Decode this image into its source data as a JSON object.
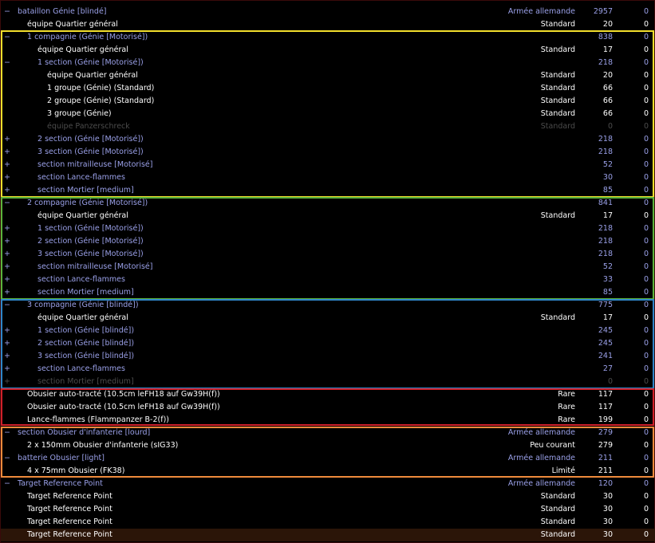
{
  "colors": {
    "group_text": "#9aa0e8",
    "unit_text": "#ffffff",
    "disabled_text": "#4c4c4c",
    "highlight_row": "#2b1508",
    "box_yellow": "#f2de2c",
    "box_green": "#5cb43c",
    "box_blue": "#2f86c9",
    "box_red": "#d0202a",
    "box_orange": "#ef8a3c"
  },
  "rows": [
    {
      "exp": "−",
      "name": "bataillon Génie [blindé]",
      "cat": "Armée allemande",
      "pts": "2957",
      "last": "0",
      "indent": 1,
      "tone": "group"
    },
    {
      "exp": "",
      "name": "équipe Quartier général",
      "cat": "Standard",
      "pts": "20",
      "last": "0",
      "indent": 2,
      "tone": "unit"
    },
    {
      "exp": "−",
      "name": "1 compagnie (Génie [Motorisé])",
      "cat": "",
      "pts": "838",
      "last": "0",
      "indent": 2,
      "tone": "group"
    },
    {
      "exp": "",
      "name": "équipe Quartier général",
      "cat": "Standard",
      "pts": "17",
      "last": "0",
      "indent": 3,
      "tone": "unit"
    },
    {
      "exp": "−",
      "name": "1 section (Génie [Motorisé])",
      "cat": "",
      "pts": "218",
      "last": "0",
      "indent": 3,
      "tone": "group"
    },
    {
      "exp": "",
      "name": "équipe Quartier général",
      "cat": "Standard",
      "pts": "20",
      "last": "0",
      "indent": 4,
      "tone": "unit"
    },
    {
      "exp": "",
      "name": "1 groupe (Génie) (Standard)",
      "cat": "Standard",
      "pts": "66",
      "last": "0",
      "indent": 4,
      "tone": "unit"
    },
    {
      "exp": "",
      "name": "2 groupe (Génie) (Standard)",
      "cat": "Standard",
      "pts": "66",
      "last": "0",
      "indent": 4,
      "tone": "unit"
    },
    {
      "exp": "",
      "name": "3 groupe (Génie)",
      "cat": "Standard",
      "pts": "66",
      "last": "0",
      "indent": 4,
      "tone": "unit"
    },
    {
      "exp": "",
      "name": "équipe Panzerschreck",
      "cat": "Standard",
      "pts": "0",
      "last": "0",
      "indent": 4,
      "tone": "dim"
    },
    {
      "exp": "+",
      "name": "2 section (Génie [Motorisé])",
      "cat": "",
      "pts": "218",
      "last": "0",
      "indent": 3,
      "tone": "group"
    },
    {
      "exp": "+",
      "name": "3 section (Génie [Motorisé])",
      "cat": "",
      "pts": "218",
      "last": "0",
      "indent": 3,
      "tone": "group"
    },
    {
      "exp": "+",
      "name": "section mitrailleuse [Motorisé]",
      "cat": "",
      "pts": "52",
      "last": "0",
      "indent": 3,
      "tone": "group"
    },
    {
      "exp": "+",
      "name": "section Lance-flammes",
      "cat": "",
      "pts": "30",
      "last": "0",
      "indent": 3,
      "tone": "group"
    },
    {
      "exp": "+",
      "name": "section Mortier [medium]",
      "cat": "",
      "pts": "85",
      "last": "0",
      "indent": 3,
      "tone": "group"
    },
    {
      "exp": "−",
      "name": "2 compagnie (Génie [Motorisé])",
      "cat": "",
      "pts": "841",
      "last": "0",
      "indent": 2,
      "tone": "group"
    },
    {
      "exp": "",
      "name": "équipe Quartier général",
      "cat": "Standard",
      "pts": "17",
      "last": "0",
      "indent": 3,
      "tone": "unit"
    },
    {
      "exp": "+",
      "name": "1 section (Génie [Motorisé])",
      "cat": "",
      "pts": "218",
      "last": "0",
      "indent": 3,
      "tone": "group"
    },
    {
      "exp": "+",
      "name": "2 section (Génie [Motorisé])",
      "cat": "",
      "pts": "218",
      "last": "0",
      "indent": 3,
      "tone": "group"
    },
    {
      "exp": "+",
      "name": "3 section (Génie [Motorisé])",
      "cat": "",
      "pts": "218",
      "last": "0",
      "indent": 3,
      "tone": "group"
    },
    {
      "exp": "+",
      "name": "section mitrailleuse [Motorisé]",
      "cat": "",
      "pts": "52",
      "last": "0",
      "indent": 3,
      "tone": "group"
    },
    {
      "exp": "+",
      "name": "section Lance-flammes",
      "cat": "",
      "pts": "33",
      "last": "0",
      "indent": 3,
      "tone": "group"
    },
    {
      "exp": "+",
      "name": "section Mortier [medium]",
      "cat": "",
      "pts": "85",
      "last": "0",
      "indent": 3,
      "tone": "group"
    },
    {
      "exp": "−",
      "name": "3 compagnie (Génie [blindé])",
      "cat": "",
      "pts": "775",
      "last": "0",
      "indent": 2,
      "tone": "group"
    },
    {
      "exp": "",
      "name": "équipe Quartier général",
      "cat": "Standard",
      "pts": "17",
      "last": "0",
      "indent": 3,
      "tone": "unit"
    },
    {
      "exp": "+",
      "name": "1 section (Génie [blindé])",
      "cat": "",
      "pts": "245",
      "last": "0",
      "indent": 3,
      "tone": "group"
    },
    {
      "exp": "+",
      "name": "2 section (Génie [blindé])",
      "cat": "",
      "pts": "245",
      "last": "0",
      "indent": 3,
      "tone": "group"
    },
    {
      "exp": "+",
      "name": "3 section (Génie [blindé])",
      "cat": "",
      "pts": "241",
      "last": "0",
      "indent": 3,
      "tone": "group"
    },
    {
      "exp": "+",
      "name": "section Lance-flammes",
      "cat": "",
      "pts": "27",
      "last": "0",
      "indent": 3,
      "tone": "group"
    },
    {
      "exp": "+",
      "name": "section Mortier [medium]",
      "cat": "",
      "pts": "0",
      "last": "0",
      "indent": 3,
      "tone": "dim"
    },
    {
      "exp": "",
      "name": "Obusier auto-tracté (10.5cm leFH18 auf Gw39H(f))",
      "cat": "Rare",
      "pts": "117",
      "last": "0",
      "indent": 2,
      "tone": "unit"
    },
    {
      "exp": "",
      "name": "Obusier auto-tracté (10.5cm leFH18 auf Gw39H(f))",
      "cat": "Rare",
      "pts": "117",
      "last": "0",
      "indent": 2,
      "tone": "unit"
    },
    {
      "exp": "",
      "name": "Lance-flammes (Flammpanzer B-2(f))",
      "cat": "Rare",
      "pts": "199",
      "last": "0",
      "indent": 2,
      "tone": "unit"
    },
    {
      "exp": "−",
      "name": "section Obusier d'infanterie [lourd]",
      "cat": "Armée allemande",
      "pts": "279",
      "last": "0",
      "indent": 1,
      "tone": "group"
    },
    {
      "exp": "",
      "name": "2 x 150mm Obusier d'infanterie (sIG33)",
      "cat": "Peu courant",
      "pts": "279",
      "last": "0",
      "indent": 2,
      "tone": "unit"
    },
    {
      "exp": "−",
      "name": "batterie Obusier [light]",
      "cat": "Armée allemande",
      "pts": "211",
      "last": "0",
      "indent": 1,
      "tone": "group"
    },
    {
      "exp": "",
      "name": "4 x 75mm Obusier (FK38)",
      "cat": "Limité",
      "pts": "211",
      "last": "0",
      "indent": 2,
      "tone": "unit"
    },
    {
      "exp": "−",
      "name": "Target Reference Point",
      "cat": "Armée allemande",
      "pts": "120",
      "last": "0",
      "indent": 1,
      "tone": "group"
    },
    {
      "exp": "",
      "name": "Target Reference Point",
      "cat": "Standard",
      "pts": "30",
      "last": "0",
      "indent": 2,
      "tone": "unit"
    },
    {
      "exp": "",
      "name": "Target Reference Point",
      "cat": "Standard",
      "pts": "30",
      "last": "0",
      "indent": 2,
      "tone": "unit"
    },
    {
      "exp": "",
      "name": "Target Reference Point",
      "cat": "Standard",
      "pts": "30",
      "last": "0",
      "indent": 2,
      "tone": "unit"
    },
    {
      "exp": "",
      "name": "Target Reference Point",
      "cat": "Standard",
      "pts": "30",
      "last": "0",
      "indent": 2,
      "tone": "unit",
      "highlight": true
    }
  ]
}
